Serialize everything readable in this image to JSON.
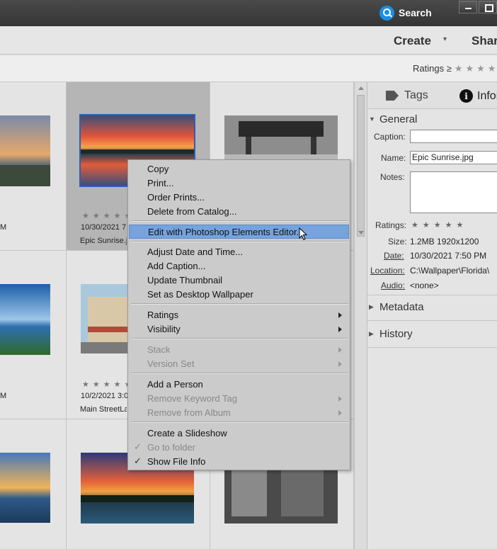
{
  "titlebar": {
    "search_label": "Search"
  },
  "menubar": {
    "create_label": "Create",
    "create_caret": "▾",
    "share_label": "Shar"
  },
  "filter": {
    "ratings_label": "Ratings ≥",
    "stars": "★★★★"
  },
  "grid": {
    "cells": [
      {
        "stars": "★★★★★",
        "date": "10/30/2021 7",
        "name": "Epic Sunrise.jpg"
      },
      {
        "date_tail": "M"
      },
      {
        "stars": "★★★★★",
        "date": "10/2/2021 3:0",
        "name": "Main StreetLa"
      },
      {
        "date_tail": "M"
      }
    ]
  },
  "panel": {
    "tab_tags": "Tags",
    "tab_info": "Infor",
    "info_glyph": "i",
    "general_label": "General",
    "caption_label": "Caption:",
    "caption_value": "",
    "name_label": "Name:",
    "name_value": "Epic Sunrise.jpg",
    "notes_label": "Notes:",
    "ratings_label": "Ratings:",
    "ratings_stars": "★★★★★",
    "size_label": "Size:",
    "size_value": "1.2MB  1920x1200",
    "date_label": "Date:",
    "date_value": "10/30/2021 7:50 PM",
    "location_label": "Location:",
    "location_value": "C:\\Wallpaper\\Florida\\",
    "audio_label": "Audio:",
    "audio_value": "<none>",
    "metadata_label": "Metadata",
    "history_label": "History"
  },
  "context_menu": {
    "items": [
      {
        "label": "Copy"
      },
      {
        "label": "Print..."
      },
      {
        "label": "Order Prints..."
      },
      {
        "label": "Delete from Catalog..."
      },
      {
        "label": "Edit with Photoshop Elements Editor..."
      },
      {
        "label": "Adjust Date and Time..."
      },
      {
        "label": "Add Caption..."
      },
      {
        "label": "Update Thumbnail"
      },
      {
        "label": "Set as Desktop Wallpaper"
      },
      {
        "label": "Ratings"
      },
      {
        "label": "Visibility"
      },
      {
        "label": "Stack"
      },
      {
        "label": "Version Set"
      },
      {
        "label": "Add a Person"
      },
      {
        "label": "Remove Keyword Tag"
      },
      {
        "label": "Remove from Album"
      },
      {
        "label": "Create a Slideshow"
      },
      {
        "label": "Go to folder"
      },
      {
        "label": "Show File Info"
      }
    ],
    "check_glyph": "✓"
  },
  "colors": {
    "accent": "#76a3de",
    "selection_border": "#2b5fb8",
    "titlebar": "#3c3c3c"
  }
}
